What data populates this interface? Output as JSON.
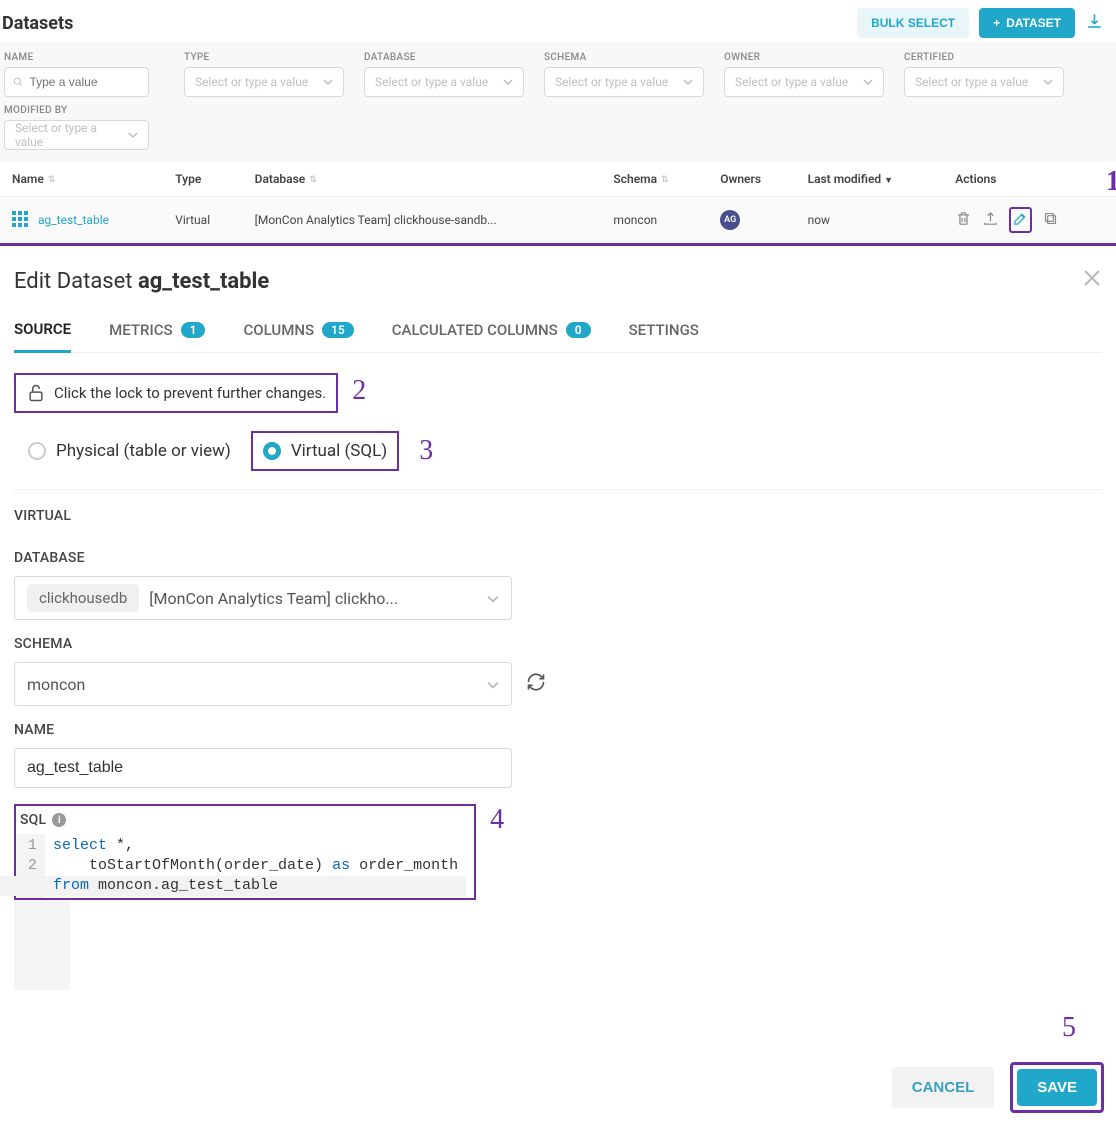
{
  "header": {
    "title": "Datasets",
    "bulk_select": "BULK SELECT",
    "add_btn": "DATASET"
  },
  "filters": {
    "name_label": "NAME",
    "name_placeholder": "Type a value",
    "type_label": "TYPE",
    "database_label": "DATABASE",
    "schema_label": "SCHEMA",
    "owner_label": "OWNER",
    "certified_label": "CERTIFIED",
    "modifiedby_label": "MODIFIED BY",
    "select_placeholder": "Select or type a value"
  },
  "table": {
    "cols": {
      "name": "Name",
      "type": "Type",
      "database": "Database",
      "schema": "Schema",
      "owners": "Owners",
      "last_modified": "Last modified",
      "actions": "Actions"
    },
    "row": {
      "name": "ag_test_table",
      "type": "Virtual",
      "database": "[MonCon Analytics Team] clickhouse-sandb...",
      "schema": "moncon",
      "owner_initials": "AG",
      "last_modified": "now"
    }
  },
  "annotations": {
    "a1": "1",
    "a2": "2",
    "a3": "3",
    "a4": "4",
    "a5": "5"
  },
  "modal": {
    "title_prefix": "Edit Dataset ",
    "title_name": "ag_test_table",
    "tabs": {
      "source": "SOURCE",
      "metrics": "METRICS",
      "metrics_count": "1",
      "columns": "COLUMNS",
      "columns_count": "15",
      "calc": "CALCULATED COLUMNS",
      "calc_count": "0",
      "settings": "SETTINGS"
    },
    "lock_msg": "Click the lock to prevent further changes.",
    "radio_physical": "Physical (table or view)",
    "radio_virtual": "Virtual (SQL)",
    "virtual_label": "VIRTUAL",
    "database_label": "DATABASE",
    "database_chip": "clickhousedb",
    "database_value": "[MonCon Analytics Team] clickho...",
    "schema_label": "SCHEMA",
    "schema_value": "moncon",
    "name_label": "NAME",
    "name_value": "ag_test_table",
    "sql_label": "SQL",
    "sql_lines": {
      "l1a": "select",
      "l1b": " *,",
      "l2a": "    toStartOfMonth(order_date) ",
      "l2b": "as",
      "l2c": " order_month",
      "l3a": "from",
      "l3b": " moncon.ag_test_table"
    }
  },
  "footer": {
    "cancel": "CANCEL",
    "save": "SAVE"
  }
}
